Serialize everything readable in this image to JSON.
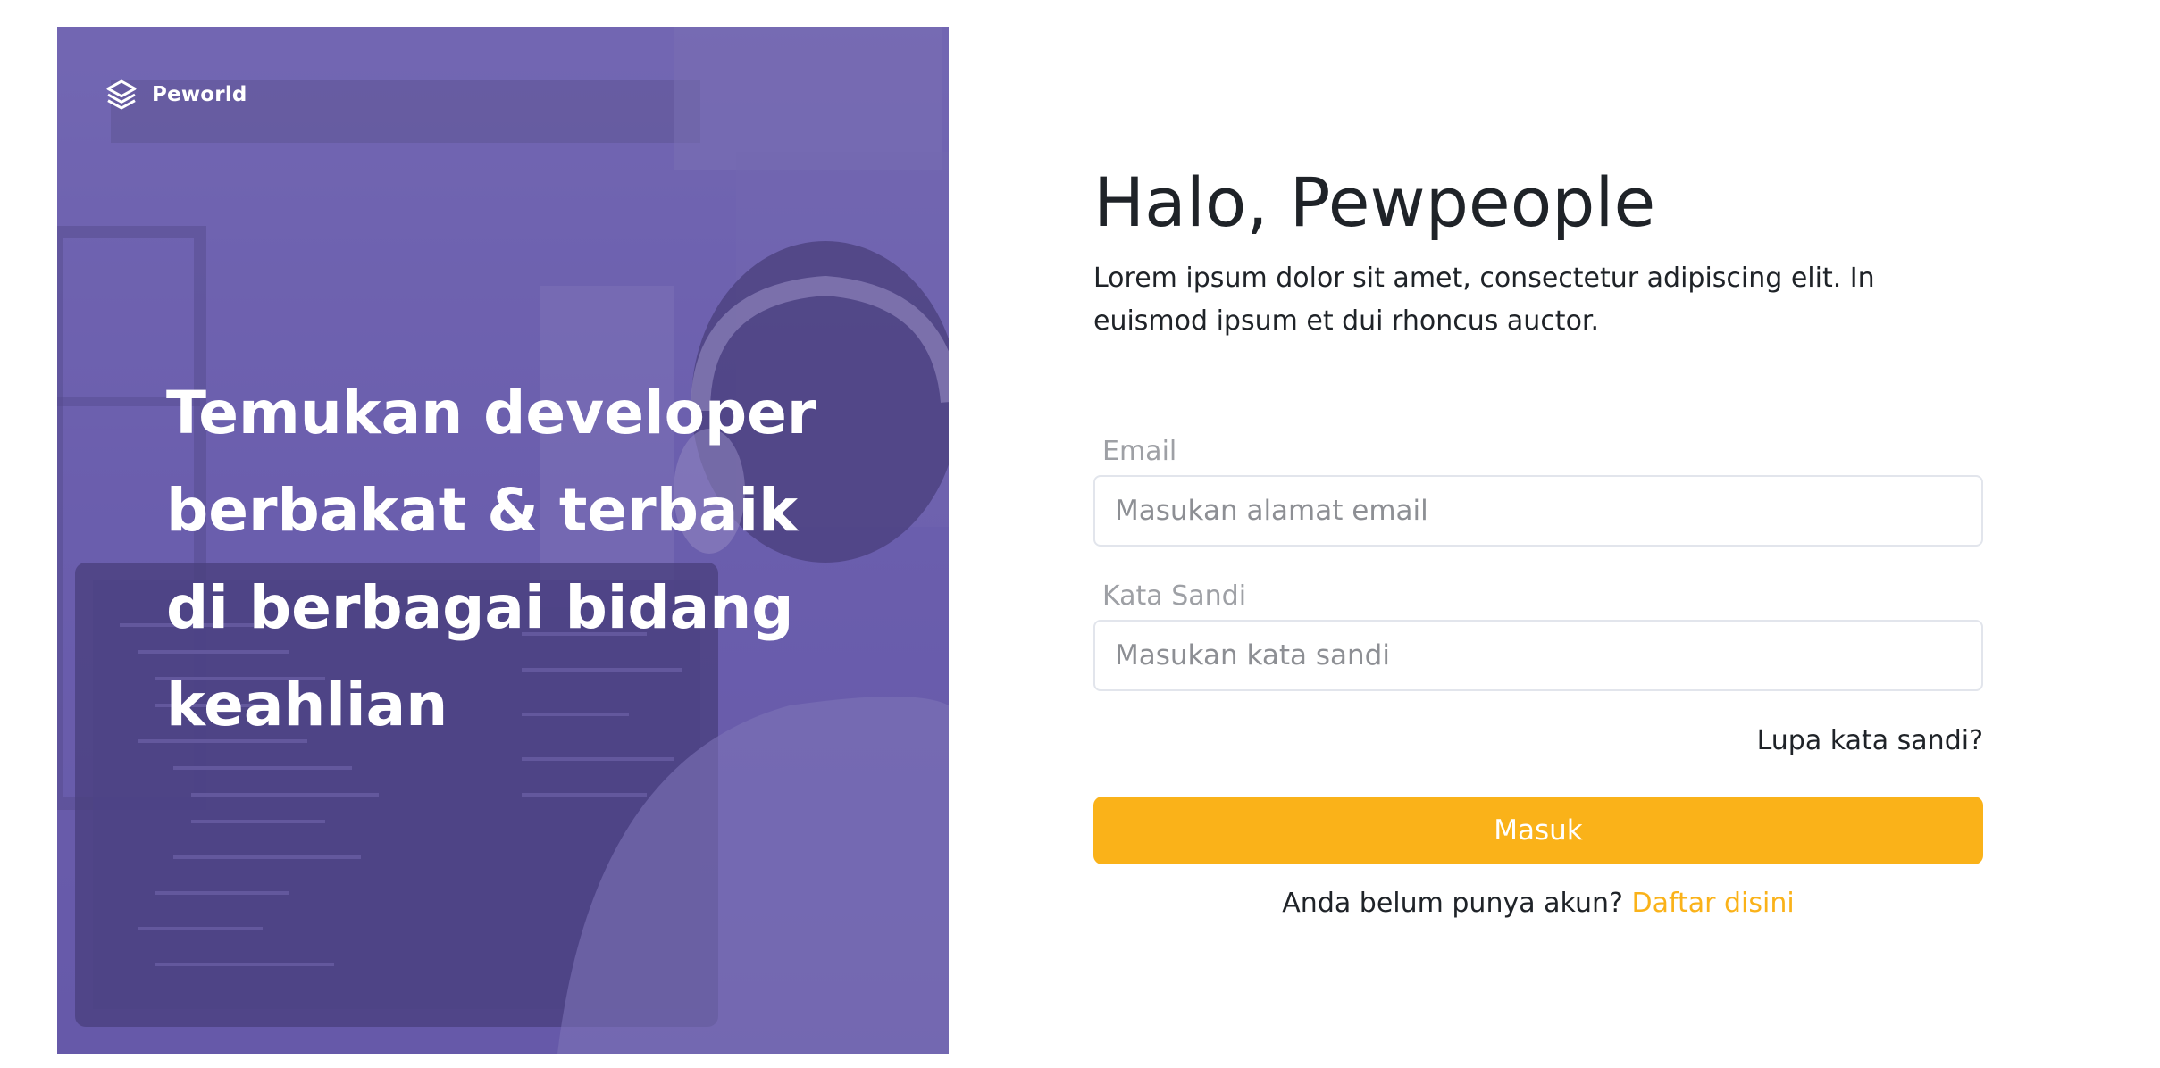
{
  "brand": {
    "name": "Peworld",
    "icon": "layers-icon"
  },
  "hero": {
    "headline_lines": [
      "Temukan developer",
      "berbakat & terbaik",
      "di berbagai bidang",
      "keahlian"
    ]
  },
  "login": {
    "title": "Halo, Pewpeople",
    "subtitle": "Lorem ipsum dolor sit amet, consectetur adipiscing elit. In euismod ipsum et dui rhoncus auctor.",
    "email": {
      "label": "Email",
      "placeholder": "Masukan alamat email",
      "value": ""
    },
    "password": {
      "label": "Kata Sandi",
      "placeholder": "Masukan kata sandi",
      "value": ""
    },
    "forgot_password": "Lupa kata sandi?",
    "submit_label": "Masuk",
    "register_prompt": "Anda belum punya akun?",
    "register_link": "Daftar disini"
  },
  "colors": {
    "hero_overlay": "#5e50a1",
    "accent": "#fab219",
    "text": "#1f2328",
    "label": "#9ea0a5"
  }
}
